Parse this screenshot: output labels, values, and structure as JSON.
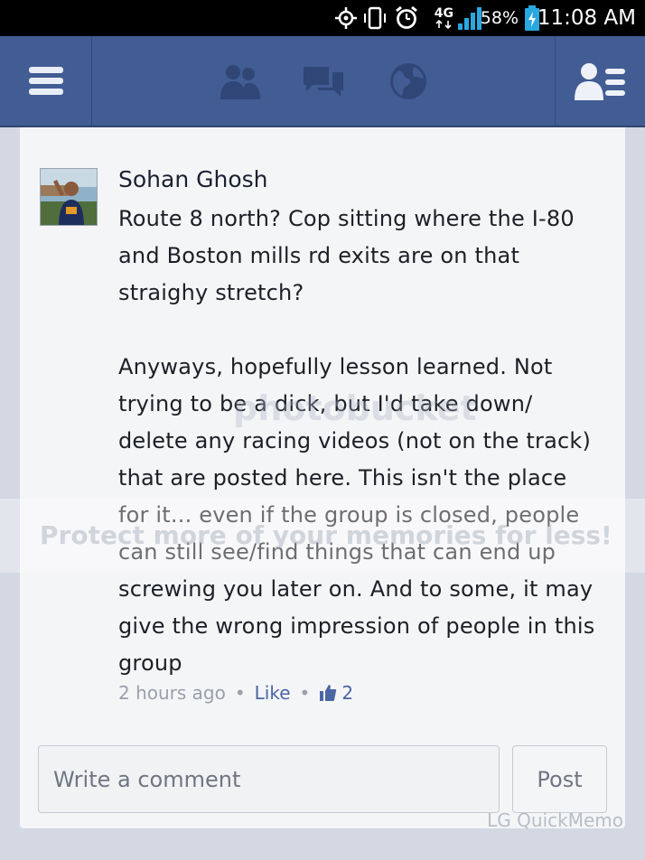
{
  "status_bar": {
    "network": "4G",
    "battery_percent": "58%",
    "time": "11:08 AM",
    "icons": [
      "gps-icon",
      "vibrate-icon",
      "alarm-icon",
      "network-4g-icon",
      "signal-icon",
      "battery-icon"
    ]
  },
  "navbar": {
    "icons": [
      "menu-icon",
      "friend-requests-icon",
      "messages-icon",
      "notifications-globe-icon",
      "contacts-list-icon"
    ]
  },
  "comment": {
    "author": "Sohan Ghosh",
    "paragraph1": "Route 8 north? Cop sitting where the I-80 and Boston mills rd exits are on that straighy stretch?",
    "paragraph2": "Anyways, hopefully lesson learned. Not trying to be a dick, but I'd take down/ delete any racing videos (not on the track) that are posted here. This isn't the place for it... even if the group is closed, people can still see/find things that can end up screwing you later on. And to some, it may give the wrong impression of people in this group",
    "time": "2 hours ago",
    "like_label": "Like",
    "like_count": "2"
  },
  "composer": {
    "placeholder": "Write a comment",
    "post_label": "Post"
  },
  "watermark": {
    "logo": "photobucket",
    "tagline": "Protect more of your memories for less!"
  },
  "quickmemo": "LG QuickMemo",
  "colors": {
    "navbar": "#425c94",
    "link": "#4c66a4",
    "card": "#f4f5f7"
  }
}
